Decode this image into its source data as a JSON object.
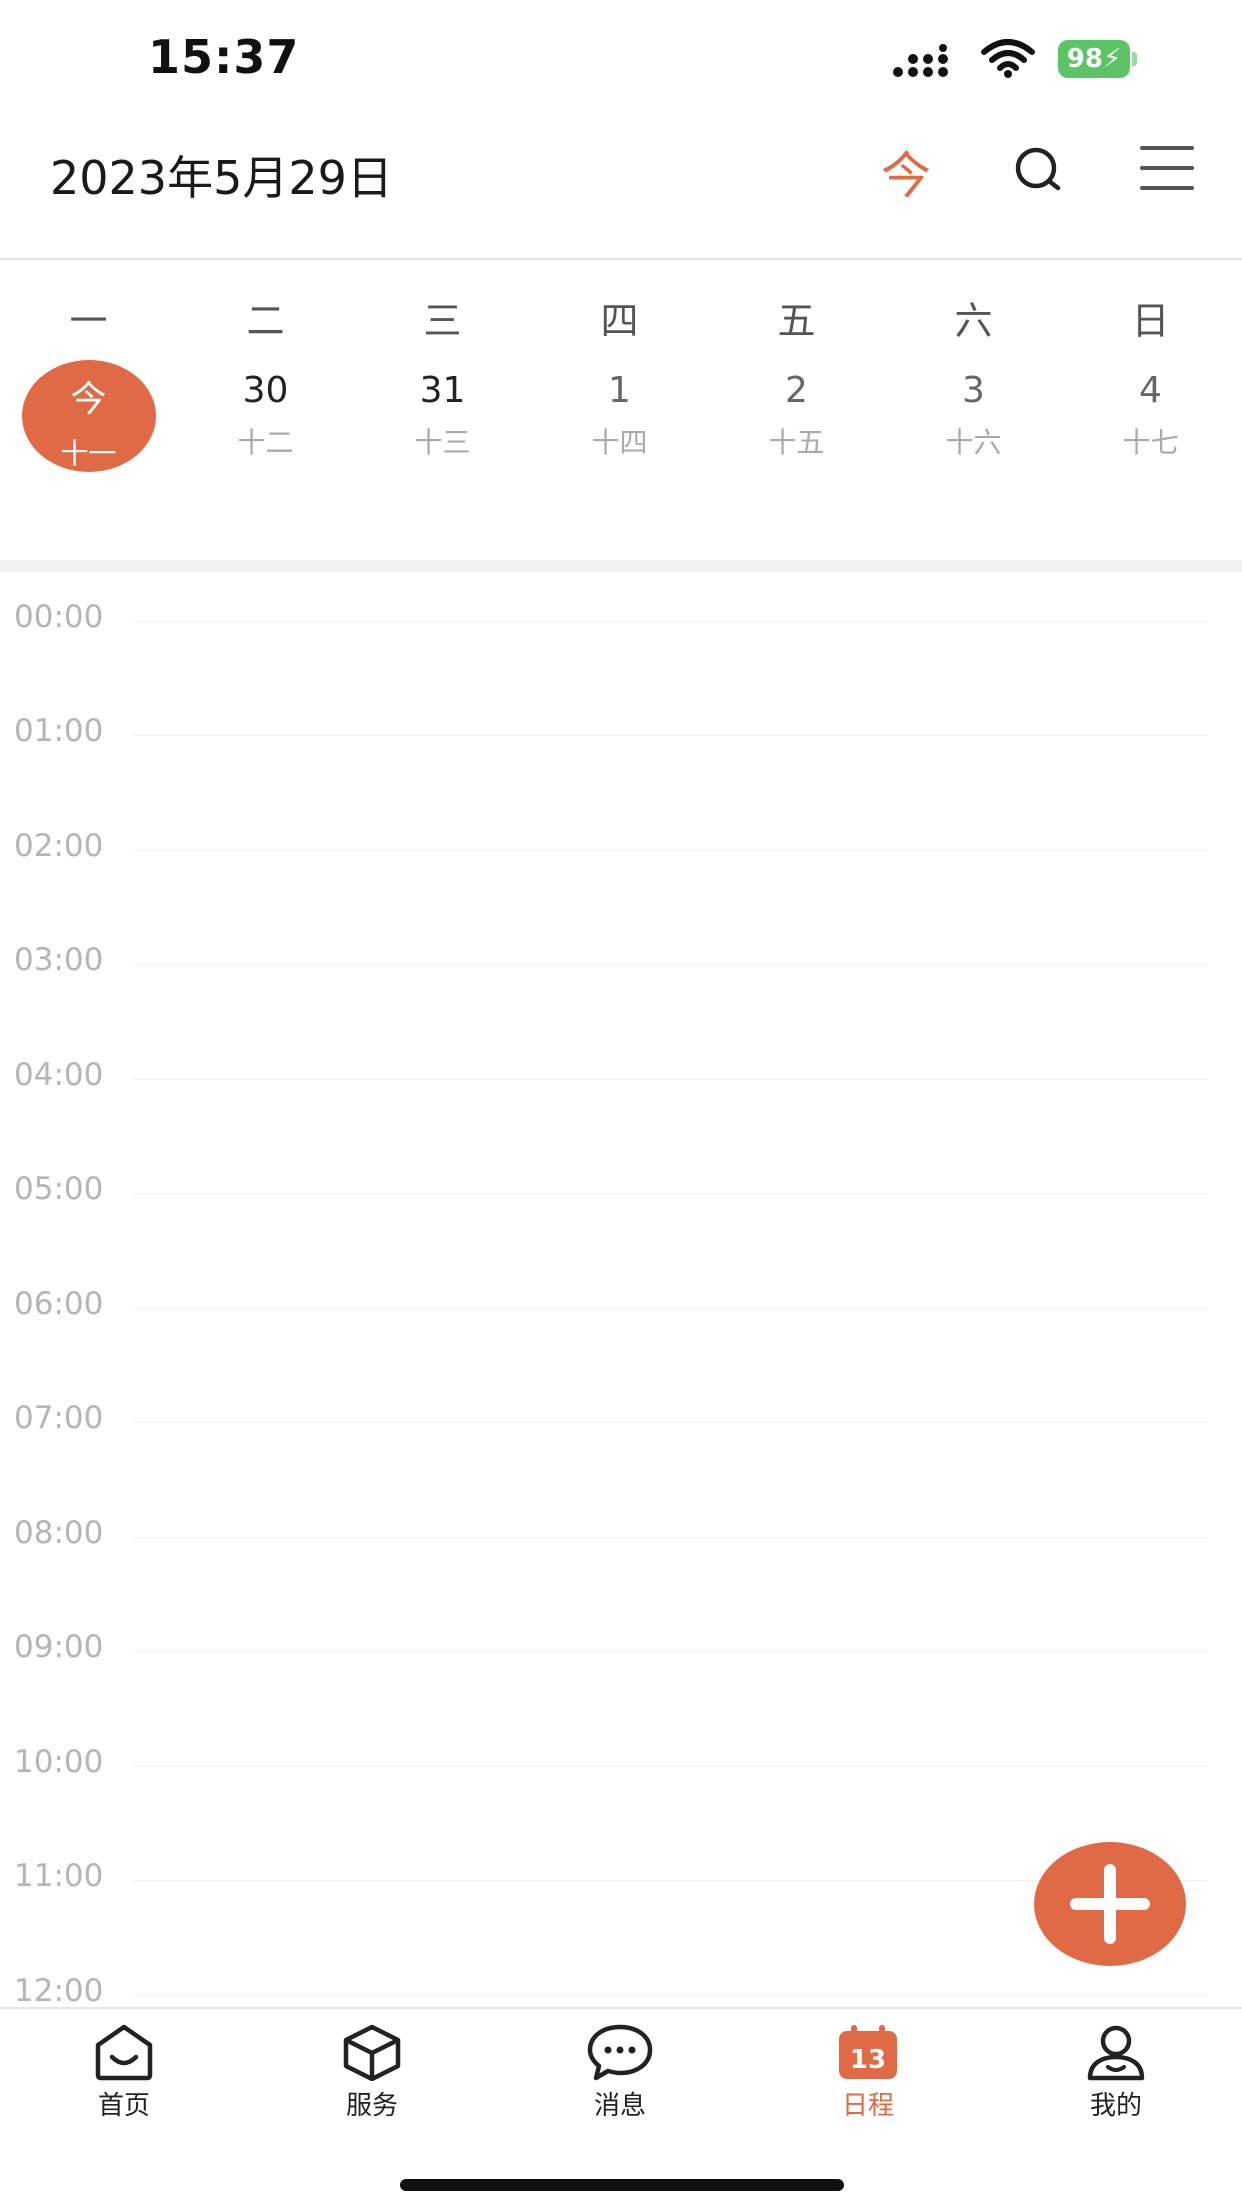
{
  "status": {
    "time": "15:37",
    "battery": "98"
  },
  "header": {
    "date": "2023年5月29日",
    "today_label": "今"
  },
  "week": {
    "weekdays": [
      "一",
      "二",
      "三",
      "四",
      "五",
      "六",
      "日"
    ],
    "days": [
      {
        "num": "今",
        "lunar": "十一"
      },
      {
        "num": "30",
        "lunar": "十二"
      },
      {
        "num": "31",
        "lunar": "十三"
      },
      {
        "num": "1",
        "lunar": "十四"
      },
      {
        "num": "2",
        "lunar": "十五"
      },
      {
        "num": "3",
        "lunar": "十六"
      },
      {
        "num": "4",
        "lunar": "十七"
      }
    ]
  },
  "timeline": {
    "hours": [
      "00:00",
      "01:00",
      "02:00",
      "03:00",
      "04:00",
      "05:00",
      "06:00",
      "07:00",
      "08:00",
      "09:00",
      "10:00",
      "11:00",
      "12:00"
    ]
  },
  "tabs": [
    {
      "label": "首页",
      "icon": "home-icon"
    },
    {
      "label": "服务",
      "icon": "cube-icon"
    },
    {
      "label": "消息",
      "icon": "chat-icon"
    },
    {
      "label": "日程",
      "icon": "calendar-icon",
      "active": true
    },
    {
      "label": "我的",
      "icon": "user-icon"
    }
  ],
  "colors": {
    "accent": "#e06a45",
    "battery": "#5cc466"
  }
}
